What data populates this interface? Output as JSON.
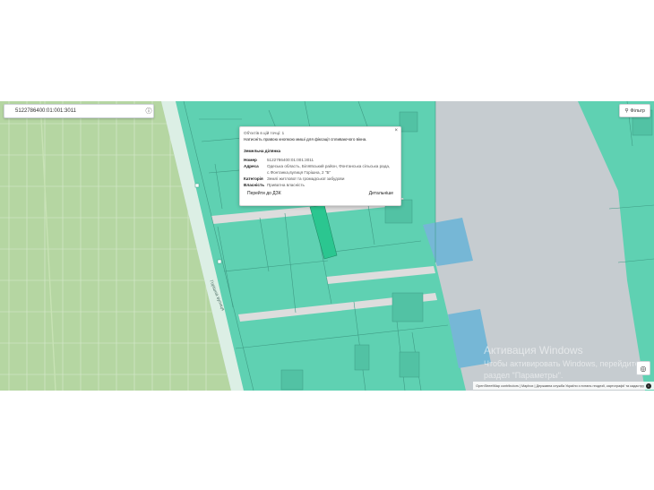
{
  "search": {
    "value": "5122786400:01:001:3011"
  },
  "filter": {
    "label": "Фільтр"
  },
  "popup": {
    "objects_count": "Об'єктів в цій точці: 1",
    "hint": "Натисніть правою кнопкою миші для фіксації спливаючого вікна.",
    "section_title": "Земельна ділянка",
    "rows": [
      {
        "key": "Номер",
        "value": "5122786400:01:001:3011"
      },
      {
        "key": "Адреса",
        "value": "Одеська область, Біляївський район, Фонтанська сільська рада, с.Фонтанка,вулиця Горішна, 2 \"Б\""
      },
      {
        "key": "Категорія",
        "value": "Землі житлової та громадської забудови"
      },
      {
        "key": "Власність",
        "value": "Приватна власність"
      }
    ],
    "button_left": "Перейти до ДЗК",
    "button_right": "Детальніше",
    "close_symbol": "×"
  },
  "map": {
    "street_label": "Горішна вулиця",
    "colors": {
      "forest": "#b5d6a2",
      "forest_line": "#d9ead0",
      "parcel": "#5fd1b2",
      "parcel_border": "#3f9c85",
      "selected": "#2bc690",
      "blue_parcel": "#76b7d6",
      "road": "#dddddd",
      "grey_area": "#c6ccd0"
    }
  },
  "attribution": {
    "text": "OpenStreetMap contributors | Mapbox | Державна служба України з питань геодезії, картографії та кадастру"
  },
  "watermark": {
    "line1": "Активация Windows",
    "line2": "Чтобы активировать Windows, перейдите в",
    "line3": "раздел \"Параметры\"."
  },
  "icons": {
    "search": "search-icon",
    "info": "info-icon",
    "filter": "filter-icon",
    "locate": "locate-icon",
    "close": "close-icon"
  }
}
